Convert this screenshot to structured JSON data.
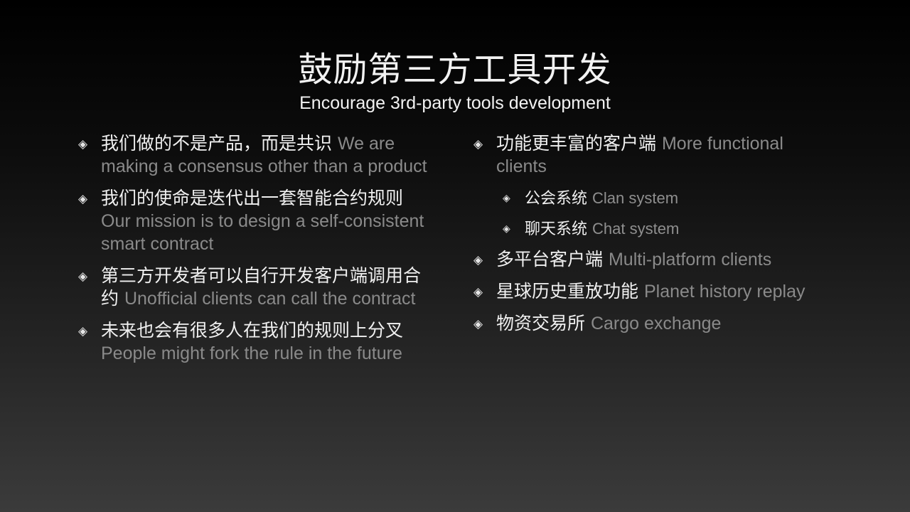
{
  "slide": {
    "title": "鼓励第三方工具开发",
    "subtitle": "Encourage 3rd-party tools development",
    "left_items": [
      {
        "zh": "我们做的不是产品，而是共识",
        "en": "We are making a consensus other than a product"
      },
      {
        "zh": "我们的使命是迭代出一套智能合约规则",
        "en": "Our mission is to design a self-consistent smart contract"
      },
      {
        "zh": "第三方开发者可以自行开发客户端调用合约",
        "en": "Unofficial clients can call the contract"
      },
      {
        "zh": "未来也会有很多人在我们的规则上分叉",
        "en": "People might fork the rule in the future"
      }
    ],
    "right_items": [
      {
        "zh": "功能更丰富的客户端",
        "en": "More functional clients"
      },
      {
        "zh": "多平台客户端",
        "en": "Multi-platform clients"
      },
      {
        "zh": "星球历史重放功能",
        "en": "Planet history replay"
      },
      {
        "zh": "物资交易所",
        "en": "Cargo exchange"
      }
    ],
    "right_subitems": [
      {
        "zh": "公会系统",
        "en": "Clan system"
      },
      {
        "zh": "聊天系统",
        "en": "Chat system"
      }
    ],
    "bullet_icon": "diamond-bullet-icon"
  }
}
